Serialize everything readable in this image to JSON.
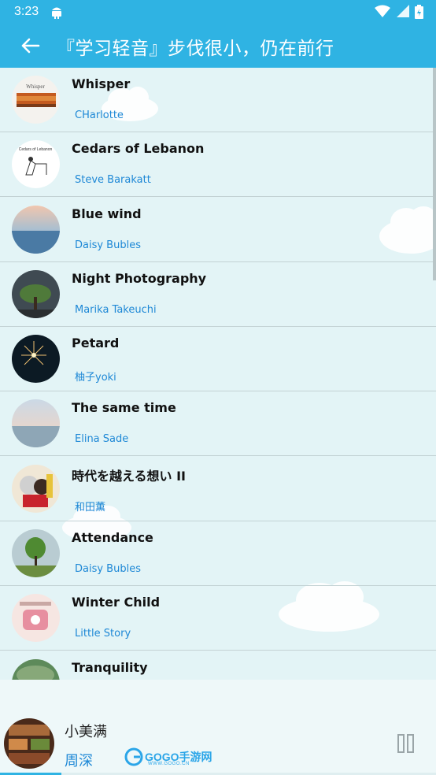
{
  "status_bar": {
    "time": "3:23"
  },
  "app_bar": {
    "title": "『学习轻音』步伐很小，仍在前行"
  },
  "songs": [
    {
      "title": "Whisper",
      "artist": "CHarlotte",
      "cover_text": "Whisper"
    },
    {
      "title": "Cedars of Lebanon",
      "artist": "Steve Barakatt",
      "cover_text": "Cedars of Lebanon"
    },
    {
      "title": "Blue wind",
      "artist": "Daisy Bubles"
    },
    {
      "title": "Night Photography",
      "artist": "Marika Takeuchi"
    },
    {
      "title": "Petard",
      "artist": "柚子yoki"
    },
    {
      "title": "The same time",
      "artist": "Elina Sade"
    },
    {
      "title": "時代を越える想い II",
      "artist": "和田薫"
    },
    {
      "title": "Attendance",
      "artist": "Daisy Bubles"
    },
    {
      "title": "Winter Child",
      "artist": "Little Story"
    },
    {
      "title": "Tranquility",
      "artist": ""
    }
  ],
  "player": {
    "title": "小美满",
    "artist": "周深",
    "progress": 0.14
  },
  "watermark": {
    "text": "GOGO手游网",
    "sub": "WWW.GOGO.CN"
  },
  "colors": {
    "accent": "#2fb3e3",
    "artist_text": "#1e88d6",
    "list_bg": "#e3f4f6"
  }
}
